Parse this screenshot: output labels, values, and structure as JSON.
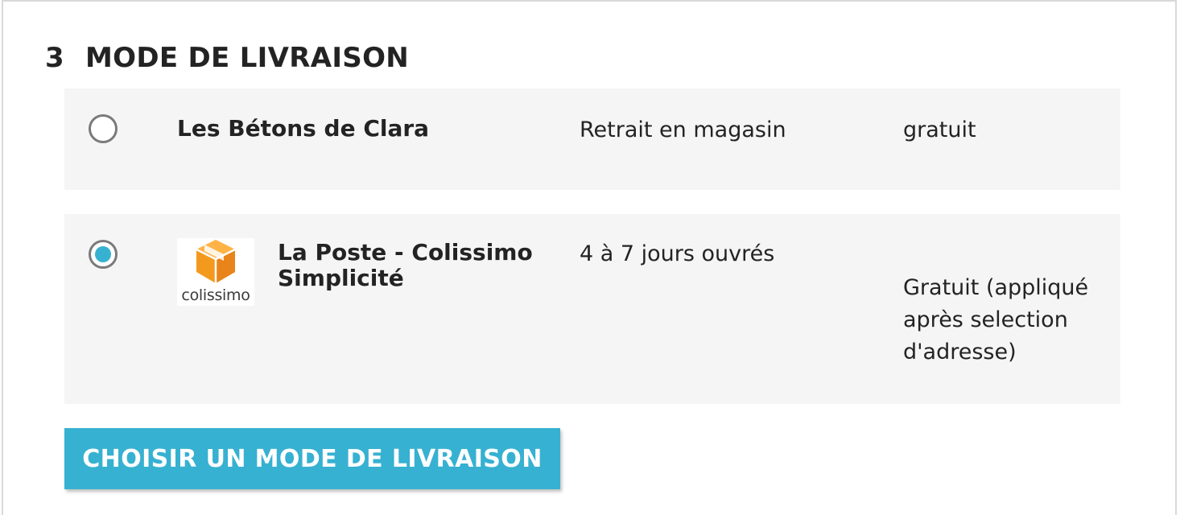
{
  "section": {
    "number": "3",
    "title": "MODE DE LIVRAISON"
  },
  "delivery_options": [
    {
      "name": "Les Bétons de Clara",
      "delay": "Retrait en magasin",
      "price": "gratuit",
      "selected": false
    },
    {
      "name": "La Poste - Colissimo Simplicité",
      "logo_text": "colissimo",
      "delay": "4 à 7 jours ouvrés",
      "price": "Gratuit (appliqué après selection d'adresse)",
      "selected": true
    }
  ],
  "submit_button": {
    "label": "CHOISIR UN MODE DE LIVRAISON"
  },
  "colors": {
    "accent": "#37b1d1",
    "option_background": "#f5f5f5",
    "logo_orange": "#f39a1e"
  }
}
